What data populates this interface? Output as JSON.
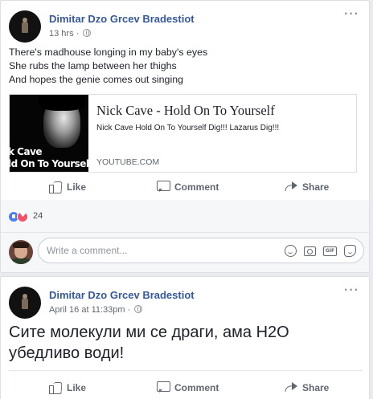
{
  "posts": [
    {
      "author": "Dimitar Dzo Grcev Bradestiot",
      "time": "13 hrs",
      "separator": "·",
      "more_icon": "more-horizontal-icon",
      "text_lines": [
        "There's madhouse longing in my baby's eyes",
        "She rubs the lamp between her thighs",
        "And hopes the genie comes out singing"
      ],
      "link": {
        "thumb_text_line1": "k Cave",
        "thumb_text_line2": "ld On To Yourself",
        "title": "Nick Cave - Hold On To Yourself",
        "description": "Nick Cave Hold On To Yourself Dig!!! Lazarus Dig!!!",
        "source": "YOUTUBE.COM"
      },
      "actions": {
        "like": "Like",
        "comment": "Comment",
        "share": "Share"
      },
      "reactions": {
        "count": "24",
        "types": [
          "like",
          "love"
        ]
      },
      "composer": {
        "placeholder": "Write a comment...",
        "gif_label": "GIF"
      }
    },
    {
      "author": "Dimitar Dzo Grcev Bradestiot",
      "time": "April 16 at 11:33pm",
      "separator": "·",
      "more_icon": "more-horizontal-icon",
      "text": "Сите молекули ми се драги, ама H2O убедливо води!",
      "actions": {
        "like": "Like",
        "comment": "Comment",
        "share": "Share"
      }
    }
  ],
  "colors": {
    "author": "#365899",
    "meta": "#616770",
    "feed_bg": "#e9ebee",
    "like_reaction": "#4a7ef6",
    "love_reaction": "#f25268"
  }
}
